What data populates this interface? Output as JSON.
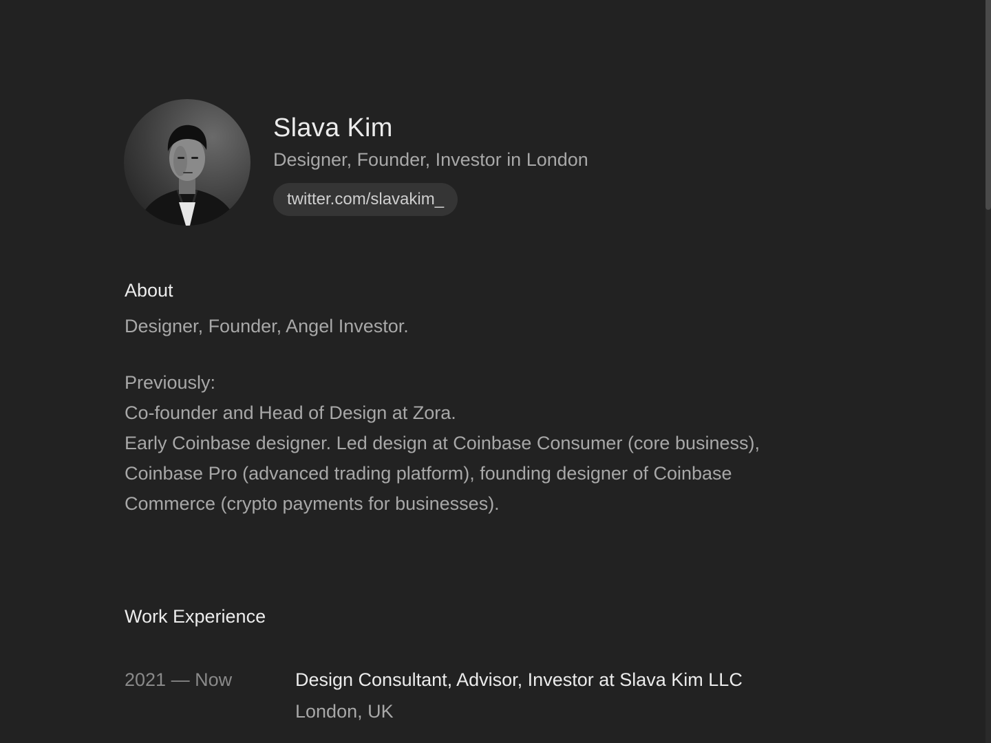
{
  "profile": {
    "name": "Slava Kim",
    "tagline": "Designer, Founder, Investor in London",
    "twitter_label": "twitter.com/slavakim_"
  },
  "about": {
    "heading": "About",
    "summary": "Designer, Founder, Angel Investor.",
    "previously_label": "Previously:",
    "lines": [
      "Co-founder and Head of Design at Zora.",
      "Early Coinbase designer. Led design at Coinbase Consumer (core business),",
      "Coinbase Pro (advanced trading platform), founding designer of Coinbase",
      "Commerce (crypto payments for businesses)."
    ]
  },
  "work": {
    "heading": "Work Experience",
    "items": [
      {
        "period": "2021 — Now",
        "title": "Design Consultant, Advisor, Investor at Slava Kim LLC",
        "location": "London, UK"
      }
    ]
  },
  "colors": {
    "background": "#222222",
    "text_primary": "#ececec",
    "text_secondary": "#a8a8a8",
    "pill_background": "#353535"
  }
}
